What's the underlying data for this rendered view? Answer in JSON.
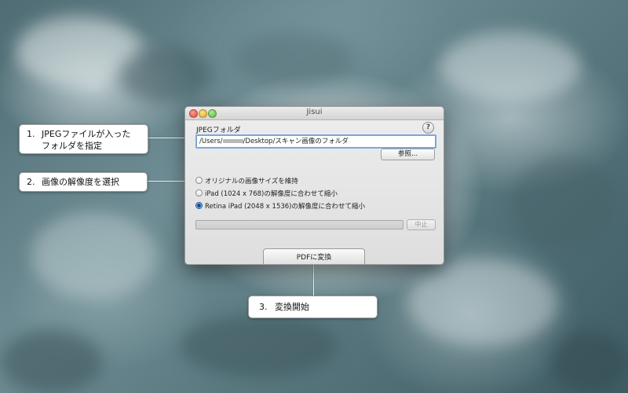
{
  "window": {
    "title": "Jisui",
    "help_label": "?",
    "folder_label": "JPEGフォルダ",
    "path_prefix": "/Users/",
    "path_suffix": "/Desktop/スキャン画像のフォルダ",
    "browse_label": "参照...",
    "radio_options": [
      {
        "label": "オリジナルの画像サイズを維持",
        "selected": false
      },
      {
        "label": "iPad (1024 x 768)の解像度に合わせて縮小",
        "selected": false
      },
      {
        "label": "Retina iPad (2048 x 1536)の解像度に合わせて縮小",
        "selected": true
      }
    ],
    "progress_fraction": 0,
    "stop_label": "中止",
    "convert_label": "PDFに変換"
  },
  "callouts": [
    {
      "number": "1.",
      "lines": [
        "JPEGファイルが入った",
        "フォルダを指定"
      ]
    },
    {
      "number": "2.",
      "lines": [
        "画像の解像度を選択"
      ]
    },
    {
      "number": "3.",
      "lines": [
        "変換開始"
      ]
    }
  ],
  "icons": {
    "close": "close-dot-icon",
    "minimize": "minimize-dot-icon",
    "zoom": "zoom-dot-icon"
  }
}
